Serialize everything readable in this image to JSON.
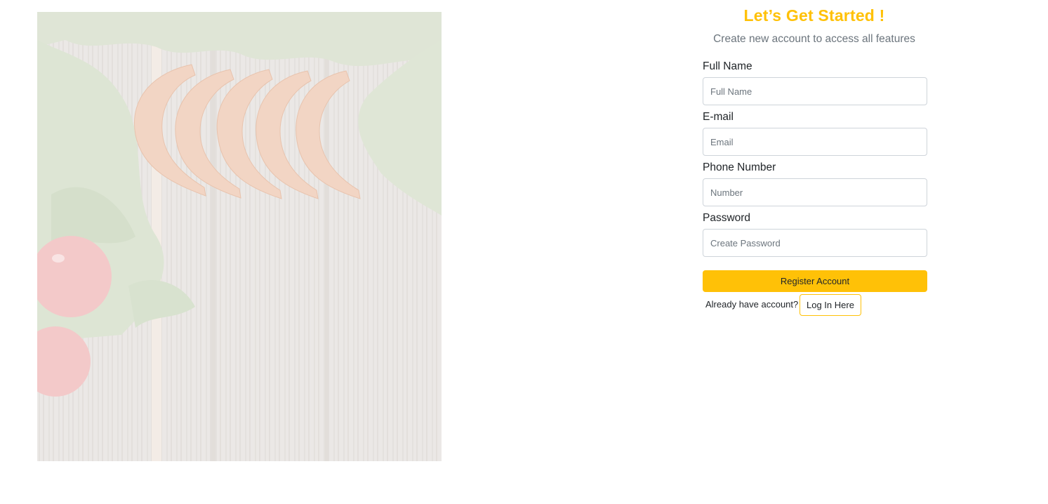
{
  "colors": {
    "accent": "#ffc107",
    "muted": "#6c757d",
    "border": "#ced4da"
  },
  "hero": {
    "image": "faded-food-wood-photo"
  },
  "header": {
    "title": "Let’s Get Started !",
    "subtitle": "Create new account to access all features"
  },
  "form": {
    "full_name": {
      "label": "Full Name",
      "placeholder": "Full Name",
      "value": ""
    },
    "email": {
      "label": "E-mail",
      "placeholder": "Email",
      "value": ""
    },
    "phone": {
      "label": "Phone Number",
      "placeholder": "Number",
      "value": ""
    },
    "password": {
      "label": "Password",
      "placeholder": "Create Password",
      "value": ""
    },
    "register_label": "Register Account",
    "already_text": "Already have account?",
    "login_label": "Log In Here"
  }
}
